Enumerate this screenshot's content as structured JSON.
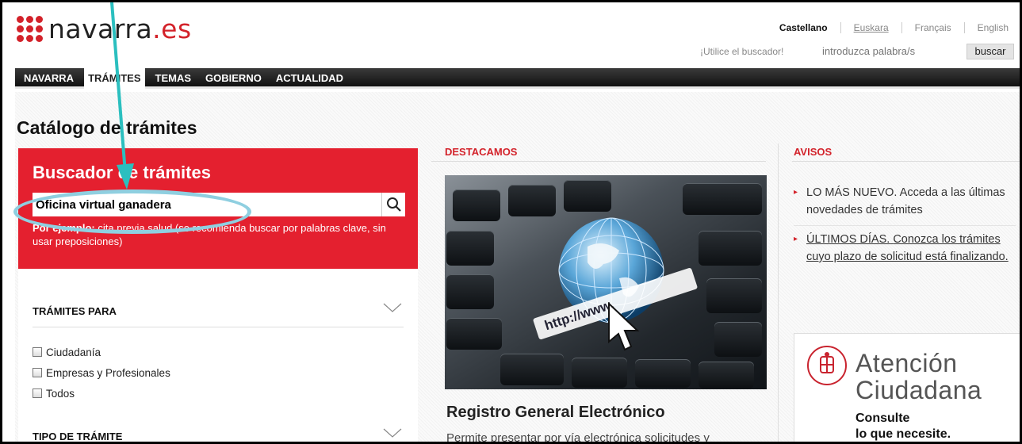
{
  "header": {
    "logo_main": "navarra",
    "logo_tld": ".es",
    "languages": [
      "Castellano",
      "Euskara",
      "Français",
      "English"
    ],
    "search_hint": "¡Utilice el buscador!",
    "search_placeholder": "introduzca palabra/s",
    "search_button": "buscar"
  },
  "nav": {
    "items": [
      "NAVARRA",
      "TRÁMITES",
      "TEMAS",
      "GOBIERNO",
      "ACTUALIDAD"
    ],
    "active": "TRÁMITES"
  },
  "page": {
    "title": "Catálogo de trámites"
  },
  "search_panel": {
    "title": "Buscador de trámites",
    "input_value": "Oficina virtual ganadera",
    "example_label": "Por ejemplo:",
    "example_text": "cita previa salud (se recomienda buscar por palabras clave, sin usar preposiciones)"
  },
  "filters": {
    "tramites_para": {
      "title": "TRÁMITES PARA",
      "options": [
        "Ciudadanía",
        "Empresas y Profesionales",
        "Todos"
      ]
    },
    "tipo_tramite": {
      "title": "TIPO DE TRÁMITE"
    }
  },
  "destacamos": {
    "heading": "DESTACAMOS",
    "item_title": "Registro General Electrónico",
    "item_desc": "Permite presentar por vía electrónica solicitudes y",
    "image_caption": "http://www."
  },
  "avisos": {
    "heading": "AVISOS",
    "items": [
      {
        "link": "LO MÁS NUEVO.",
        "text": "Acceda a las últimas novedades de trámites"
      },
      {
        "link": "ÚLTIMOS DÍAS.",
        "text": "Conozca los trámites cuyo plazo de solicitud está finalizando."
      }
    ]
  },
  "atencion": {
    "title_1": "Atención",
    "title_2": "Ciudadana",
    "sub_1": "Consulte",
    "sub_2": "lo que necesite."
  },
  "colors": {
    "brand_red": "#e4202f",
    "annotation_teal": "#2bbfbf"
  }
}
